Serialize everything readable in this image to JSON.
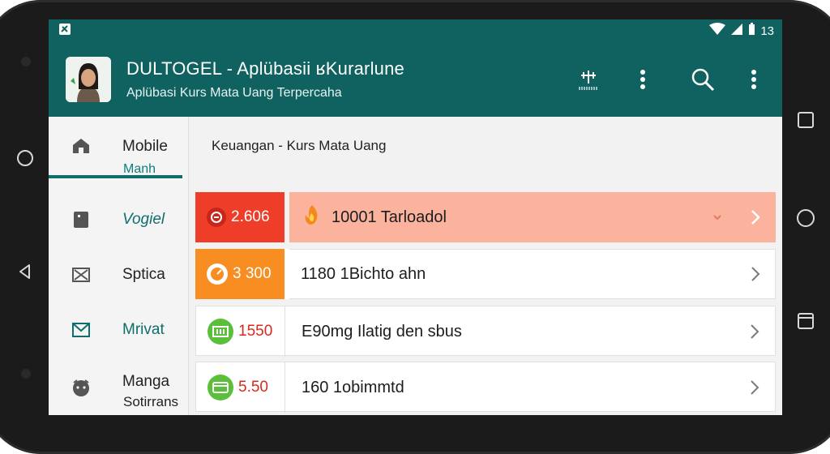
{
  "statusbar": {
    "time": "13"
  },
  "appbar": {
    "title": "DULTOGEL - Aplübasii ʁKurarlune",
    "subtitle": "Aplübasi Kurs Mata Uang Terpercaha"
  },
  "sidebar": {
    "items": [
      {
        "label": "Mobile",
        "sublabel": "Manh",
        "icon": "home-icon"
      },
      {
        "label": "Vogiel",
        "icon": "tablet-icon"
      },
      {
        "label": "Sptica",
        "icon": "mail-x-icon"
      },
      {
        "label": "Mrivat",
        "icon": "mail-icon"
      },
      {
        "label": "Manga",
        "sublabel": "Sotirrans",
        "icon": "face-icon"
      }
    ]
  },
  "main": {
    "breadcrumb": "Keuangan - Kurs Mata Uang",
    "rows": [
      {
        "value": "2.606",
        "text": "10001 Tarloadol",
        "icon": "flame-icon"
      },
      {
        "value": "3 300",
        "text": "1180 1Bichto ahn",
        "icon": "speed-icon"
      },
      {
        "value": "1550",
        "text": "E90mg Ilatig den sbus",
        "icon": "cash-icon"
      },
      {
        "value": "5.50",
        "text": "160 1obimmtd",
        "icon": "card-icon"
      }
    ]
  },
  "colors": {
    "appbar": "#0f6260",
    "accent": "#0f6e6c",
    "row1_badge": "#ee3e2a",
    "row1_bg": "#fbb39e",
    "row2_badge": "#f88e22",
    "green_icon": "#5cbf3c",
    "value_red": "#d62b1e"
  }
}
